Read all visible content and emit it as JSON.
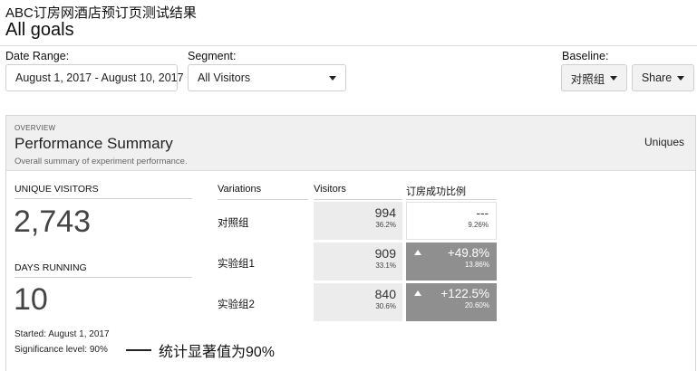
{
  "header": {
    "subtitle": "ABC订房网酒店预订页测试结果",
    "title": "All goals"
  },
  "controls": {
    "date_range_label": "Date Range:",
    "date_range_value": "August 1, 2017 - August 10, 2017",
    "segment_label": "Segment:",
    "segment_value": "All Visitors",
    "baseline_label": "Baseline:",
    "baseline_value": "对照组",
    "share_label": "Share"
  },
  "summary": {
    "overview_label": "OVERVIEW",
    "title": "Performance Summary",
    "subtitle": "Overall summary of experiment performance.",
    "metric_toggle": "Uniques",
    "unique_visitors_label": "UNIQUE VISITORS",
    "unique_visitors_value": "2,743",
    "days_running_label": "DAYS RUNNING",
    "days_running_value": "10",
    "started": "Started: August 1, 2017",
    "significance": "Significance level: 90%",
    "annotation": "统计显著值为90%"
  },
  "table": {
    "headers": {
      "variations": "Variations",
      "visitors": "Visitors",
      "metric": "订房成功比例"
    },
    "rows": [
      {
        "name": "对照组",
        "visitors": "994",
        "visitors_pct": "36.2%",
        "improvement": "---",
        "rate": "9.26%"
      },
      {
        "name": "实验组1",
        "visitors": "909",
        "visitors_pct": "33.1%",
        "improvement": "+49.8%",
        "rate": "13.86%"
      },
      {
        "name": "实验组2",
        "visitors": "840",
        "visitors_pct": "30.6%",
        "improvement": "+122.5%",
        "rate": "20.60%"
      }
    ]
  }
}
